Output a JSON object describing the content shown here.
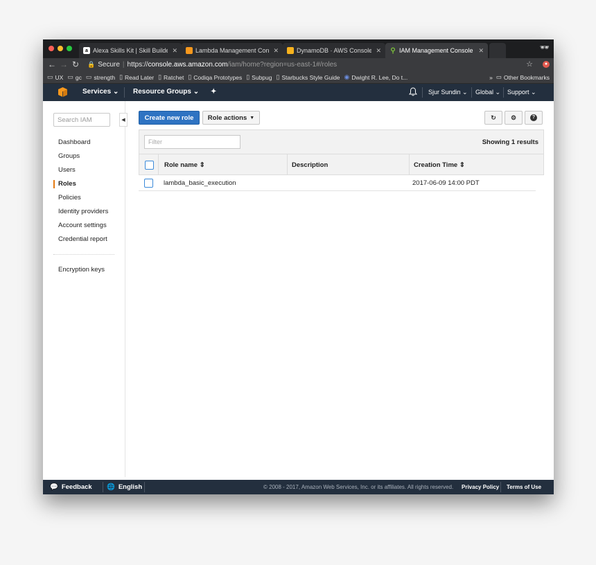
{
  "browser": {
    "tabs": [
      {
        "label": "Alexa Skills Kit | Skill Builder B",
        "favicon": "amazon-favicon"
      },
      {
        "label": "Lambda Management Console",
        "favicon": "lambda-favicon"
      },
      {
        "label": "DynamoDB · AWS Console",
        "favicon": "dynamodb-favicon"
      },
      {
        "label": "IAM Management Console",
        "favicon": "iam-favicon"
      }
    ],
    "address": {
      "secure_label": "Secure",
      "scheme": "https://",
      "host": "console.aws.amazon.com",
      "path": "/iam/home?region=us-east-1#/roles"
    },
    "bookmarks": [
      {
        "label": "UX",
        "icon": "folder-icon"
      },
      {
        "label": "gc",
        "icon": "folder-icon"
      },
      {
        "label": "strength",
        "icon": "folder-icon"
      },
      {
        "label": "Read Later",
        "icon": "page-icon"
      },
      {
        "label": "Ratchet",
        "icon": "page-icon"
      },
      {
        "label": "Codiqa Prototypes",
        "icon": "page-icon"
      },
      {
        "label": "Subpug",
        "icon": "page-icon"
      },
      {
        "label": "Starbucks Style Guide",
        "icon": "page-icon"
      },
      {
        "label": "Dwight R. Lee, Do t...",
        "icon": "site-icon"
      }
    ],
    "other_bookmarks": "Other Bookmarks",
    "more_bookmarks": "»"
  },
  "aws_nav": {
    "services": "Services",
    "resource_groups": "Resource Groups",
    "user": "Sjur Sundin",
    "region": "Global",
    "support": "Support"
  },
  "sidebar": {
    "search_placeholder": "Search IAM",
    "items": [
      {
        "label": "Dashboard"
      },
      {
        "label": "Groups"
      },
      {
        "label": "Users"
      },
      {
        "label": "Roles"
      },
      {
        "label": "Policies"
      },
      {
        "label": "Identity providers"
      },
      {
        "label": "Account settings"
      },
      {
        "label": "Credential report"
      }
    ],
    "extra": "Encryption keys"
  },
  "toolbar": {
    "create_label": "Create new role",
    "actions_label": "Role actions"
  },
  "table": {
    "filter_placeholder": "Filter",
    "results": "Showing 1 results",
    "columns": {
      "name": "Role name",
      "description": "Description",
      "created": "Creation Time"
    },
    "rows": [
      {
        "name": "lambda_basic_execution",
        "description": "",
        "created": "2017-06-09 14:00 PDT"
      }
    ]
  },
  "footer": {
    "feedback": "Feedback",
    "language": "English",
    "copyright": "© 2008 - 2017, Amazon Web Services, Inc. or its affiliates. All rights reserved.",
    "privacy": "Privacy Policy",
    "terms": "Terms of Use"
  },
  "colors": {
    "aws_nav": "#232f3e",
    "primary_button": "#2e73c2",
    "active_marker": "#e47911",
    "aws_orange": "#f7981d"
  }
}
